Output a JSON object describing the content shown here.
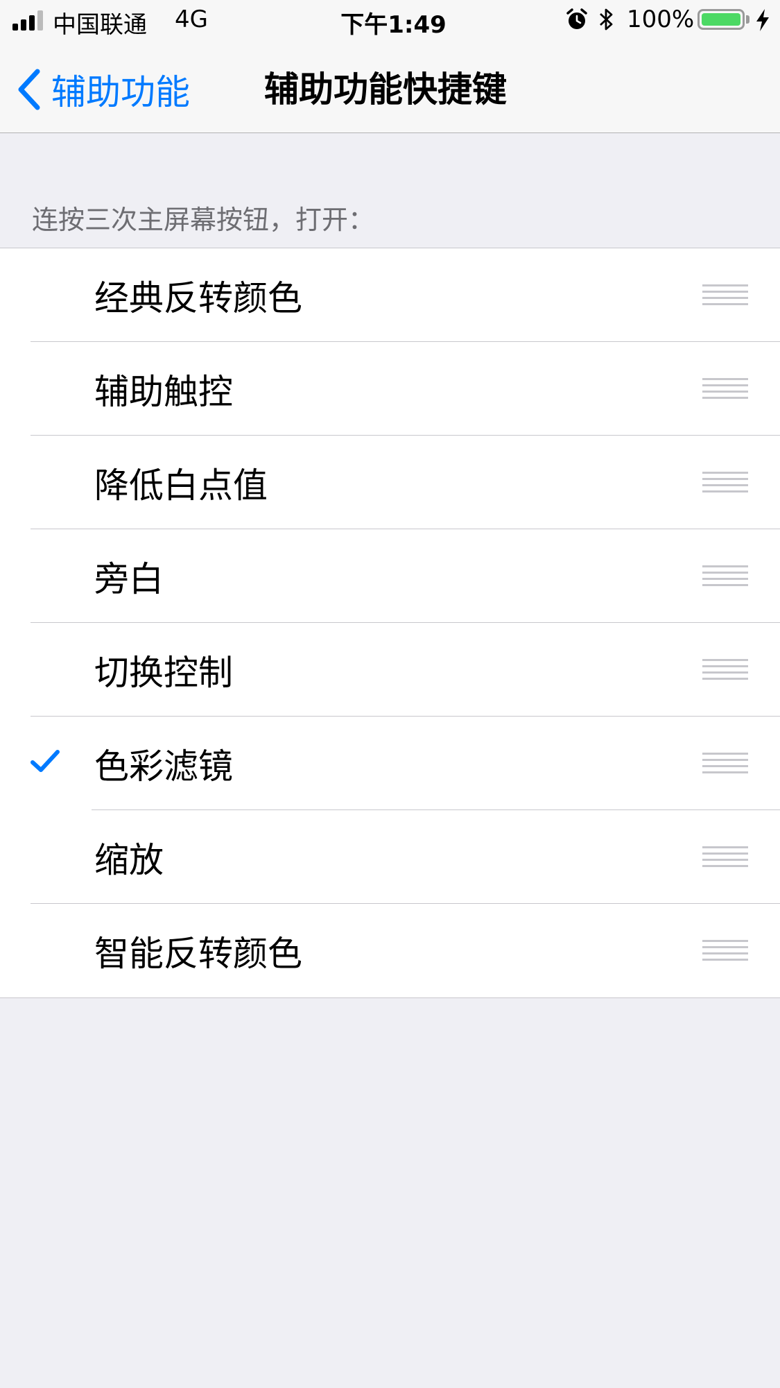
{
  "status_bar": {
    "carrier": "中国联通",
    "network": "4G",
    "time": "下午1:49",
    "battery_percent": "100%",
    "battery_level": 1.0,
    "battery_color": "#4cd964"
  },
  "nav": {
    "back_label": "辅助功能",
    "title": "辅助功能快捷键",
    "accent": "#007aff"
  },
  "section": {
    "header": "连按三次主屏幕按钮，打开："
  },
  "items": [
    {
      "label": "经典反转颜色",
      "checked": false
    },
    {
      "label": "辅助触控",
      "checked": false
    },
    {
      "label": "降低白点值",
      "checked": false
    },
    {
      "label": "旁白",
      "checked": false
    },
    {
      "label": "切换控制",
      "checked": false
    },
    {
      "label": "色彩滤镜",
      "checked": true
    },
    {
      "label": "缩放",
      "checked": false
    },
    {
      "label": "智能反转颜色",
      "checked": false
    }
  ],
  "icons": {
    "signal": "signal-bars-icon",
    "alarm": "alarm-clock-icon",
    "bluetooth": "bluetooth-icon",
    "battery": "battery-icon",
    "charging": "charging-bolt-icon",
    "back": "chevron-left-icon",
    "check": "checkmark-icon",
    "reorder": "reorder-handle-icon"
  }
}
